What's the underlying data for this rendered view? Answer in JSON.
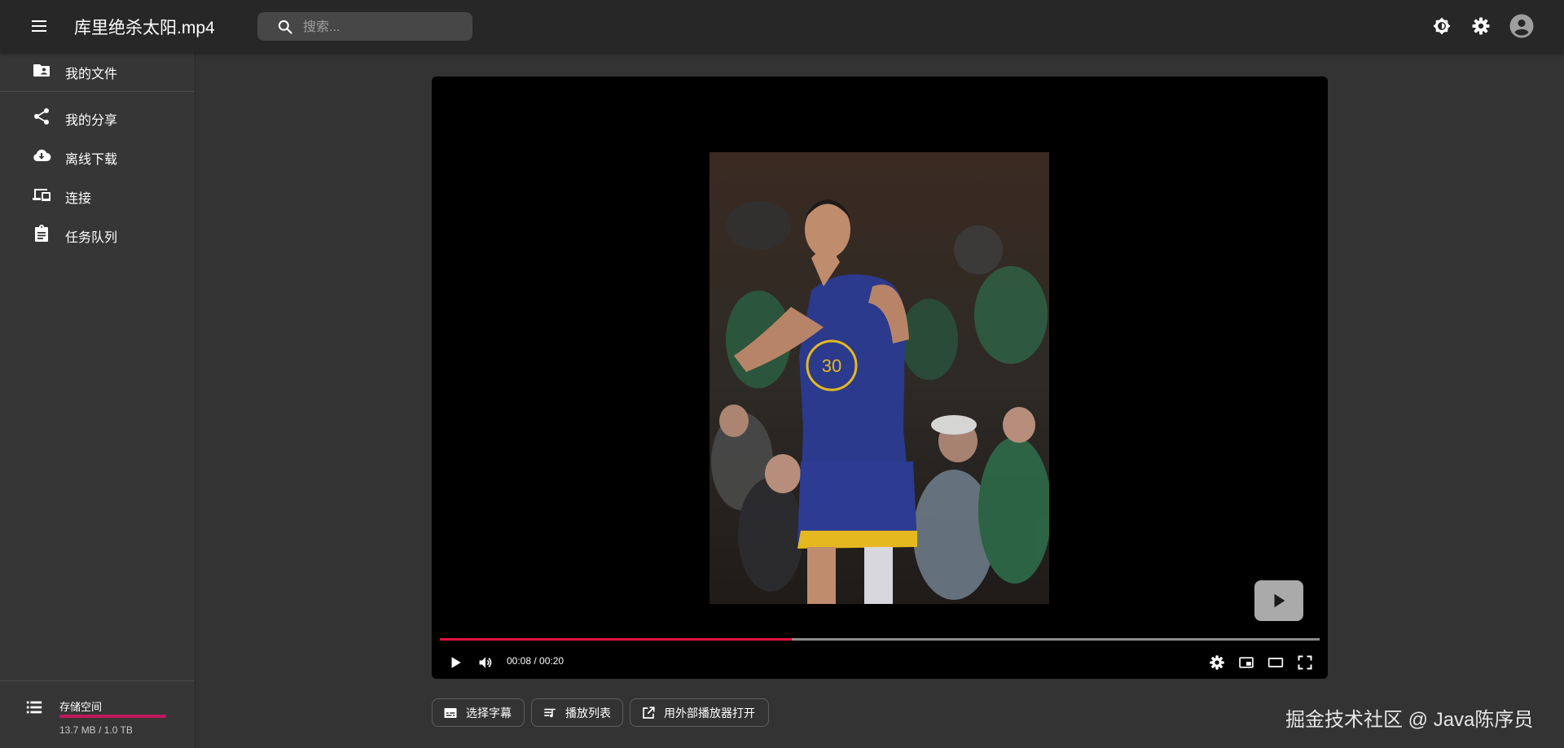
{
  "header": {
    "title": "库里绝杀太阳.mp4",
    "search_placeholder": "搜索..."
  },
  "sidebar": {
    "items": [
      {
        "label": "我的文件",
        "icon": "folder-account-icon"
      },
      {
        "label": "我的分享",
        "icon": "share-icon"
      },
      {
        "label": "离线下载",
        "icon": "cloud-download-icon"
      },
      {
        "label": "连接",
        "icon": "devices-icon"
      },
      {
        "label": "任务队列",
        "icon": "clipboard-list-icon"
      }
    ],
    "storage": {
      "label": "存储空间",
      "usage": "13.7 MB / 1.0 TB",
      "used_fraction": 1.0
    }
  },
  "player": {
    "time": "00:08 / 00:20",
    "progress_fraction": 0.4
  },
  "actions": {
    "subtitle": "选择字幕",
    "playlist": "播放列表",
    "external": "用外部播放器打开"
  },
  "watermark": "掘金技术社区 @ Java陈序员",
  "colors": {
    "accent": "#e0143c",
    "storage_bar": "#c2185b"
  }
}
